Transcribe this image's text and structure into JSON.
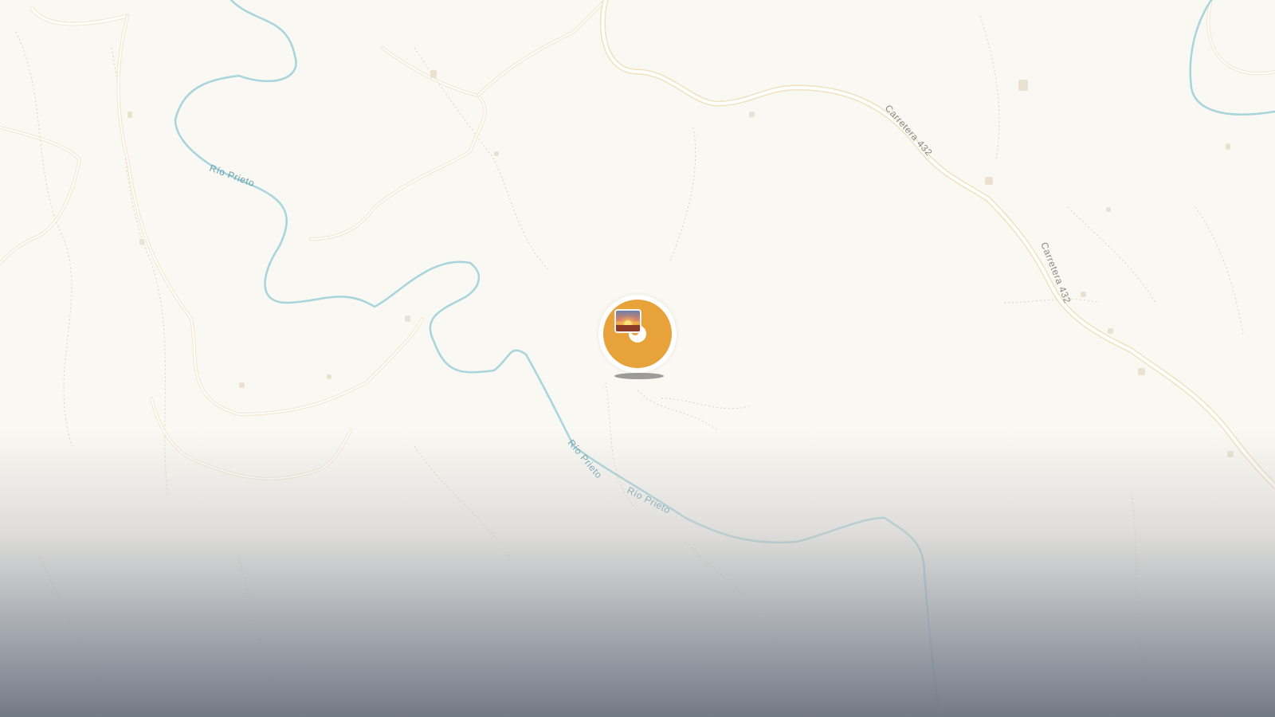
{
  "map": {
    "rivers": [
      {
        "name": "Río Prieto"
      },
      {
        "name": "Río Prieto"
      },
      {
        "name": "Río Prieto"
      }
    ],
    "roads": [
      {
        "name": "Carretera 432"
      },
      {
        "name": "Carretera 432"
      }
    ],
    "marker": {
      "type": "photo-marker",
      "icon": "sunset-photo-icon",
      "color": "#e8a23a"
    },
    "colors": {
      "land": "#faf8f2",
      "river": "#a8d4dc",
      "road": "#ffffff",
      "road_casing": "#efe6cc",
      "path": "#d8d4c8"
    }
  }
}
